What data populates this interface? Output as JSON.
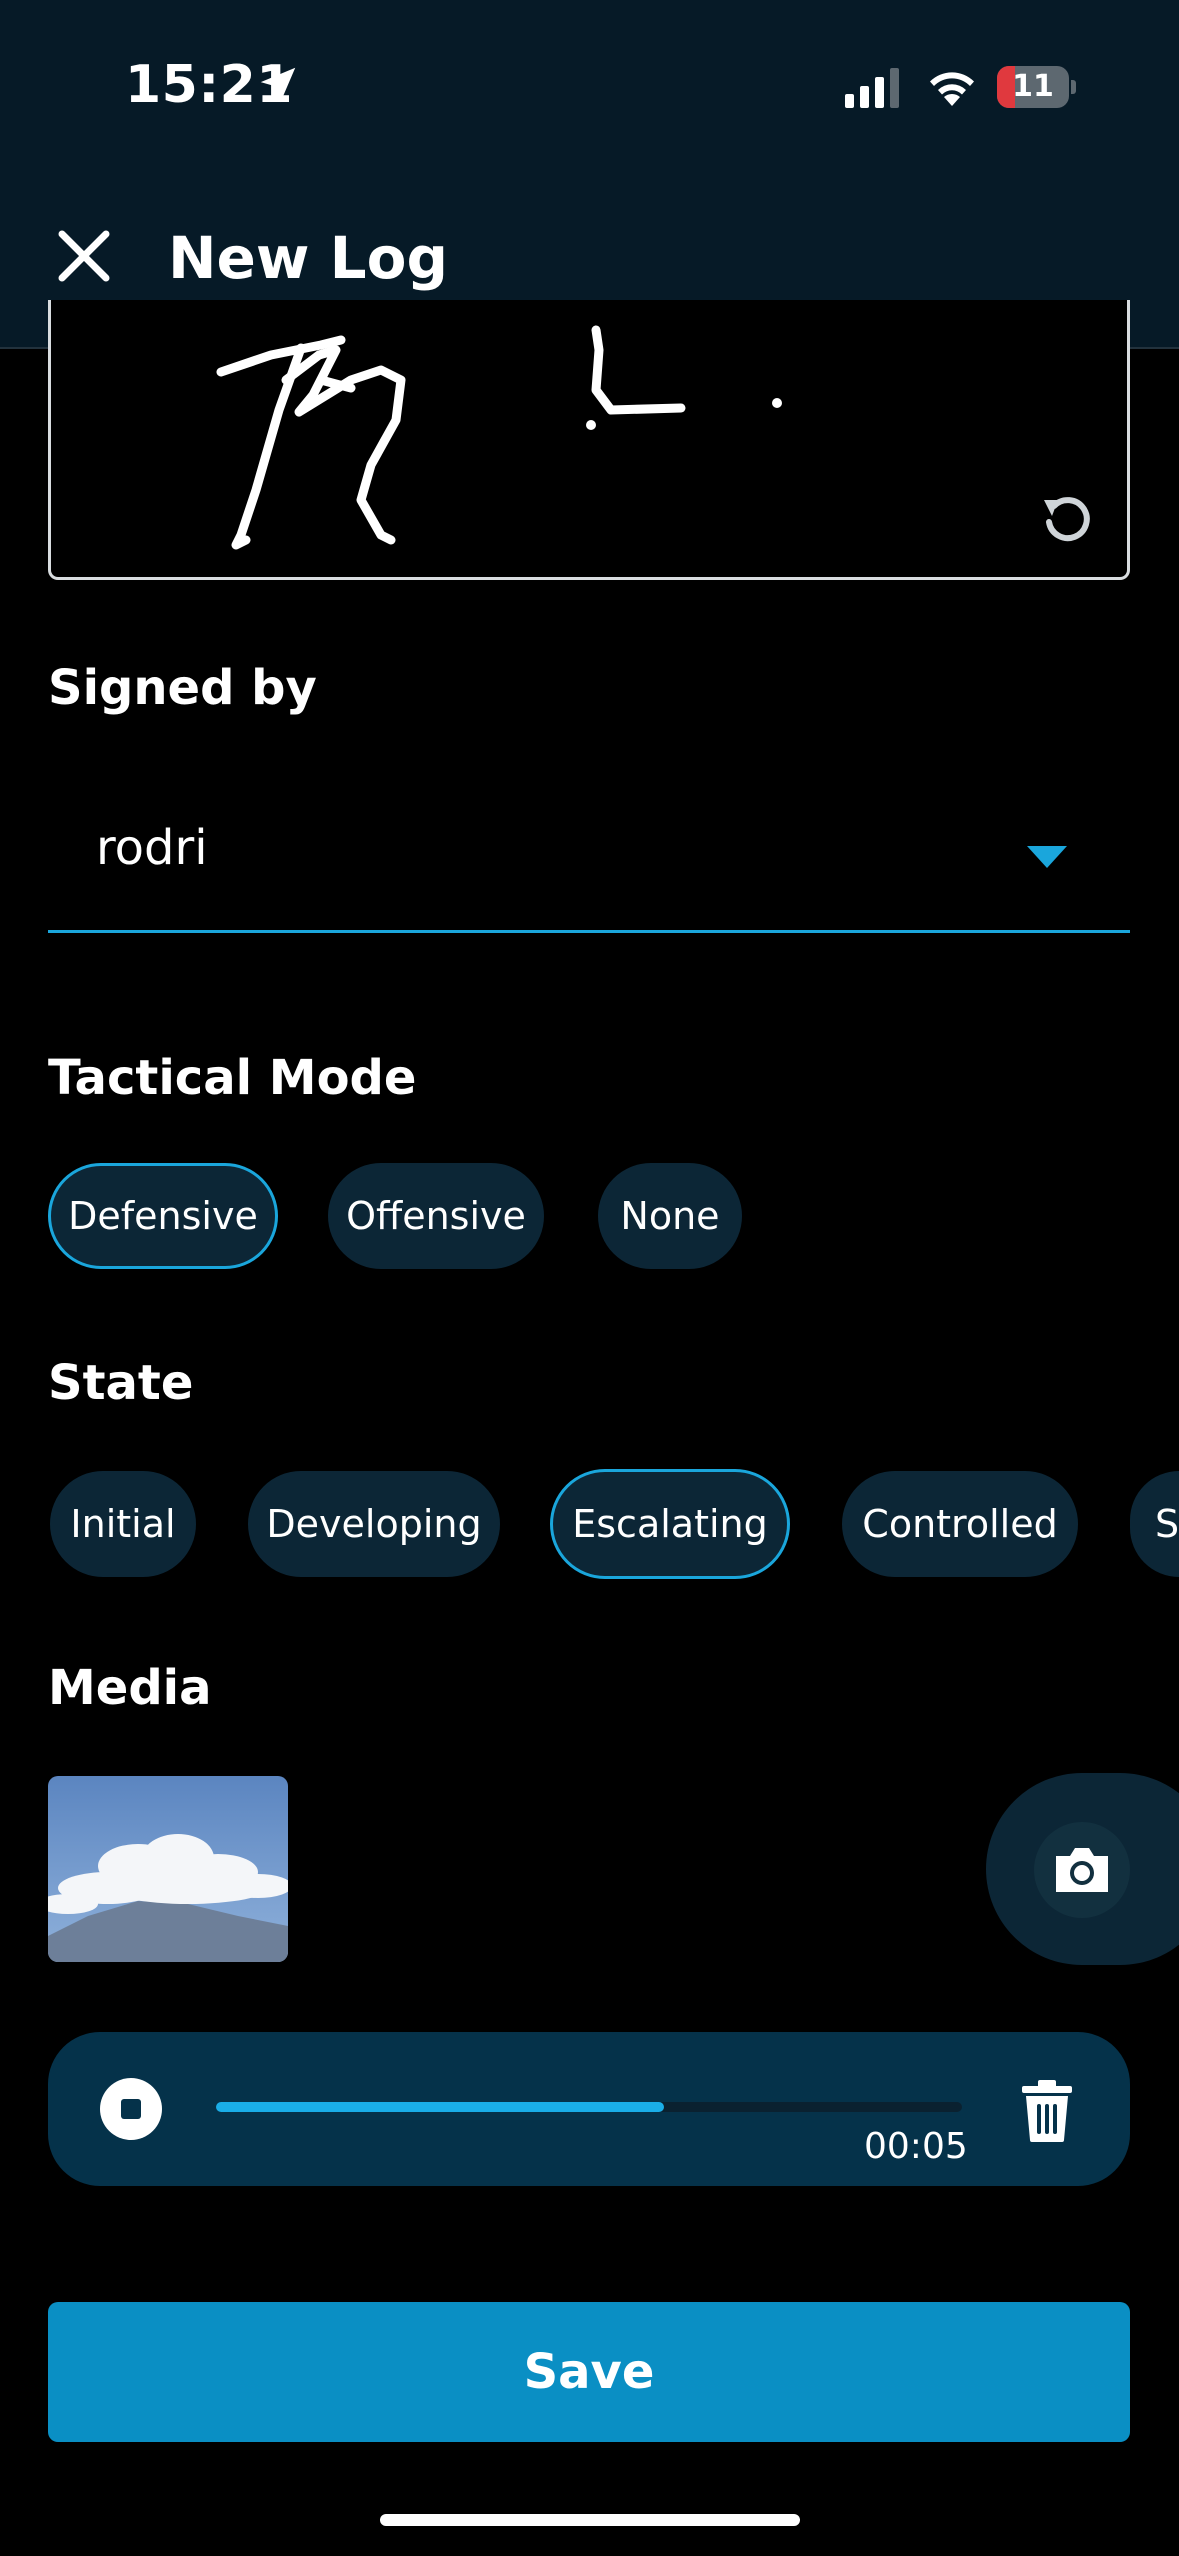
{
  "status_bar": {
    "time": "15:21",
    "battery": "11",
    "icons": [
      "location-arrow-icon",
      "cellular-signal-icon",
      "wifi-icon",
      "battery-icon"
    ]
  },
  "header": {
    "title": "New Log",
    "close_icon": "close-icon"
  },
  "signature": {
    "reset_icon": "reset-icon"
  },
  "signed_by": {
    "label": "Signed by",
    "value": "rodri"
  },
  "tactical_mode": {
    "label": "Tactical Mode",
    "options": [
      "Defensive",
      "Offensive",
      "None"
    ],
    "selected": "Defensive"
  },
  "state": {
    "label": "State",
    "options": [
      "Initial",
      "Developing",
      "Escalating",
      "Controlled",
      "S"
    ],
    "selected": "Escalating"
  },
  "media": {
    "label": "Media",
    "camera_icon": "camera-icon"
  },
  "audio": {
    "elapsed": "00:05",
    "progress": 0.6,
    "stop_icon": "stop-icon",
    "delete_icon": "trash-icon"
  },
  "save_label": "Save",
  "colors": {
    "accent": "#1aa6dc",
    "header_bg": "#061a27",
    "chip_bg": "#0c2636",
    "audio_bg": "#05324a",
    "save_bg": "#0a8fc4"
  }
}
